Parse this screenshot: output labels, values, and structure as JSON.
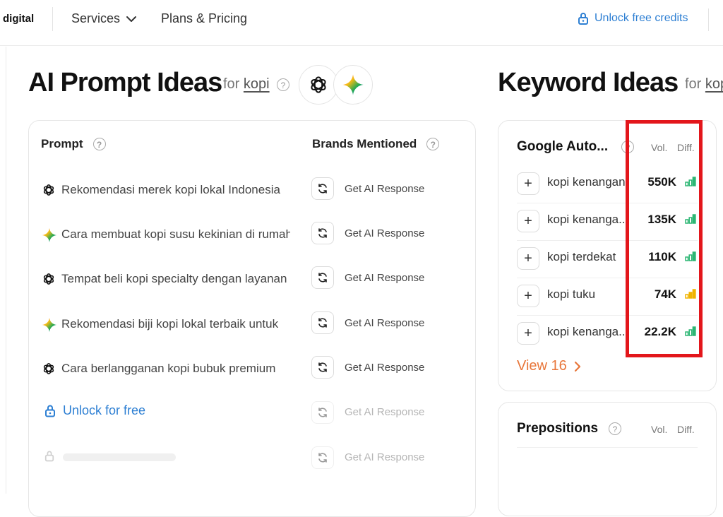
{
  "nav": {
    "brand": "digital",
    "services_label": "Services",
    "pricing_label": "Plans & Pricing",
    "unlock_credits_label": "Unlock free credits"
  },
  "ai_section": {
    "title": "AI Prompt Ideas",
    "for_label": "for",
    "term": "kopi",
    "models": [
      "chatgpt-icon",
      "gemini-icon"
    ],
    "columns": {
      "prompt": "Prompt",
      "brands": "Brands Mentioned"
    },
    "rows": [
      {
        "model": "chatgpt-icon",
        "text": "Rekomendasi merek kopi lokal Indonesia",
        "action": "Get AI Response"
      },
      {
        "model": "gemini-icon",
        "text": "Cara membuat kopi susu kekinian di rumah",
        "action": "Get AI Response"
      },
      {
        "model": "chatgpt-icon",
        "text": "Tempat beli kopi specialty dengan layanan",
        "action": "Get AI Response"
      },
      {
        "model": "gemini-icon",
        "text": "Rekomendasi biji kopi lokal terbaik untuk",
        "action": "Get AI Response"
      },
      {
        "model": "chatgpt-icon",
        "text": "Cara berlangganan kopi bubuk premium",
        "action": "Get AI Response"
      }
    ],
    "unlock_label": "Unlock for free",
    "locked_actions": [
      "Get AI Response",
      "Get AI Response"
    ]
  },
  "keyword_section": {
    "title": "Keyword Ideas",
    "for_label": "for",
    "term": "kopi",
    "autocomplete": {
      "title": "Google Auto...",
      "vol_label": "Vol.",
      "diff_label": "Diff.",
      "rows": [
        {
          "keyword": "kopi kenangan",
          "volume": "550K",
          "difficulty": "easy",
          "diff_color": "#2bb673"
        },
        {
          "keyword": "kopi kenanga...",
          "volume": "135K",
          "difficulty": "easy",
          "diff_color": "#2bb673"
        },
        {
          "keyword": "kopi terdekat",
          "volume": "110K",
          "difficulty": "easy",
          "diff_color": "#2bb673"
        },
        {
          "keyword": "kopi tuku",
          "volume": "74K",
          "difficulty": "medium",
          "diff_color": "#f0b400"
        },
        {
          "keyword": "kopi kenanga...",
          "volume": "22.2K",
          "difficulty": "easy",
          "diff_color": "#2bb673"
        }
      ],
      "view_more_label": "View 16"
    },
    "prepositions": {
      "title": "Prepositions",
      "vol_label": "Vol.",
      "diff_label": "Diff."
    }
  },
  "colors": {
    "accent_blue": "#2d7fd3",
    "view_more_orange": "#e8763a",
    "highlight_red": "#e3161b"
  }
}
